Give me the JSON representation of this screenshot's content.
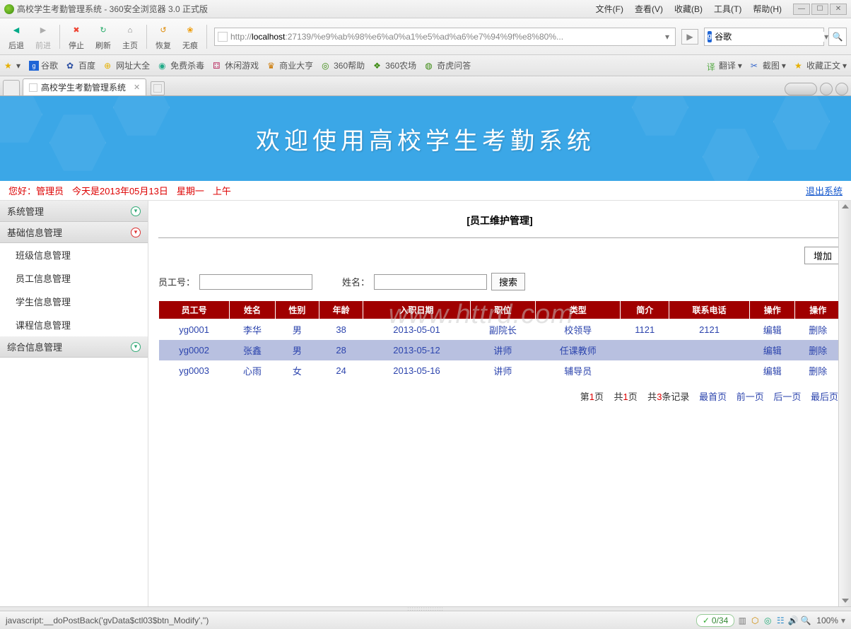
{
  "browser": {
    "title": "高校学生考勤管理系统 - 360安全浏览器 3.0 正式版",
    "menu": {
      "file": "文件(F)",
      "view": "查看(V)",
      "fav": "收藏(B)",
      "tools": "工具(T)",
      "help": "帮助(H)"
    },
    "nav": {
      "back": "后退",
      "forward": "前进",
      "stop": "停止",
      "refresh": "刷新",
      "home": "主页",
      "restore": "恢复",
      "incognito": "无痕"
    },
    "url_prefix": "http://",
    "url_host": "localhost",
    "url_path": ":27139/%e9%ab%98%e6%a0%a1%e5%ad%a6%e7%94%9f%e8%80%...",
    "search_engine_label": "谷歌",
    "tab_title": "高校学生考勤管理系统",
    "bookmarks": [
      "谷歌",
      "百度",
      "网址大全",
      "免费杀毒",
      "休闲游戏",
      "商业大亨",
      "360帮助",
      "360农场",
      "奇虎问答"
    ],
    "bm_right": {
      "translate": "翻译",
      "screenshot": "截图",
      "favtext": "收藏正文"
    }
  },
  "banner": {
    "title": "欢迎使用高校学生考勤系统"
  },
  "greet": {
    "hello": "您好：",
    "role": "管理员",
    "date": "今天是2013年05月13日",
    "weekday": "星期一",
    "ampm": "上午",
    "logout": "退出系统"
  },
  "sidebar": {
    "menus": [
      {
        "label": "系统管理",
        "expanded": false
      },
      {
        "label": "基础信息管理",
        "expanded": true,
        "items": [
          {
            "label": "班级信息管理"
          },
          {
            "label": "员工信息管理"
          },
          {
            "label": "学生信息管理"
          },
          {
            "label": "课程信息管理"
          }
        ]
      },
      {
        "label": "综合信息管理",
        "expanded": false
      }
    ]
  },
  "content": {
    "title": "[员工维护管理]",
    "add_btn": "增加",
    "search": {
      "id_label": "员工号：",
      "name_label": "姓名：",
      "btn": "搜索"
    },
    "columns": [
      "员工号",
      "姓名",
      "性别",
      "年龄",
      "入职日期",
      "职位",
      "类型",
      "简介",
      "联系电话",
      "操作",
      "操作"
    ],
    "rows": [
      {
        "id": "yg0001",
        "name": "李华",
        "sex": "男",
        "age": "38",
        "date": "2013-05-01",
        "pos": "副院长",
        "type": "校领导",
        "intro": "1121",
        "tel": "2121",
        "edit": "编辑",
        "del": "删除"
      },
      {
        "id": "yg0002",
        "name": "张鑫",
        "sex": "男",
        "age": "28",
        "date": "2013-05-12",
        "pos": "讲师",
        "type": "任课教师",
        "intro": "",
        "tel": "",
        "edit": "编辑",
        "del": "删除"
      },
      {
        "id": "yg0003",
        "name": "心雨",
        "sex": "女",
        "age": "24",
        "date": "2013-05-16",
        "pos": "讲师",
        "type": "辅导员",
        "intro": "",
        "tel": "",
        "edit": "编辑",
        "del": "删除"
      }
    ],
    "pager": {
      "cur_prefix": "第",
      "cur": "1",
      "page_suffix": "页",
      "total_prefix": "共",
      "total": "1",
      "rec_prefix": "共",
      "rec": "3",
      "rec_suffix": "条记录",
      "first": "最首页",
      "prev": "前一页",
      "next": "后一页",
      "last": "最后页"
    }
  },
  "status": {
    "left": "javascript:__doPostBack('gvData$ctl03$btn_Modify','')",
    "pill_icon": "✓",
    "pill_text": "0/34",
    "zoom": "100%"
  },
  "watermark": "www.httrd.com"
}
